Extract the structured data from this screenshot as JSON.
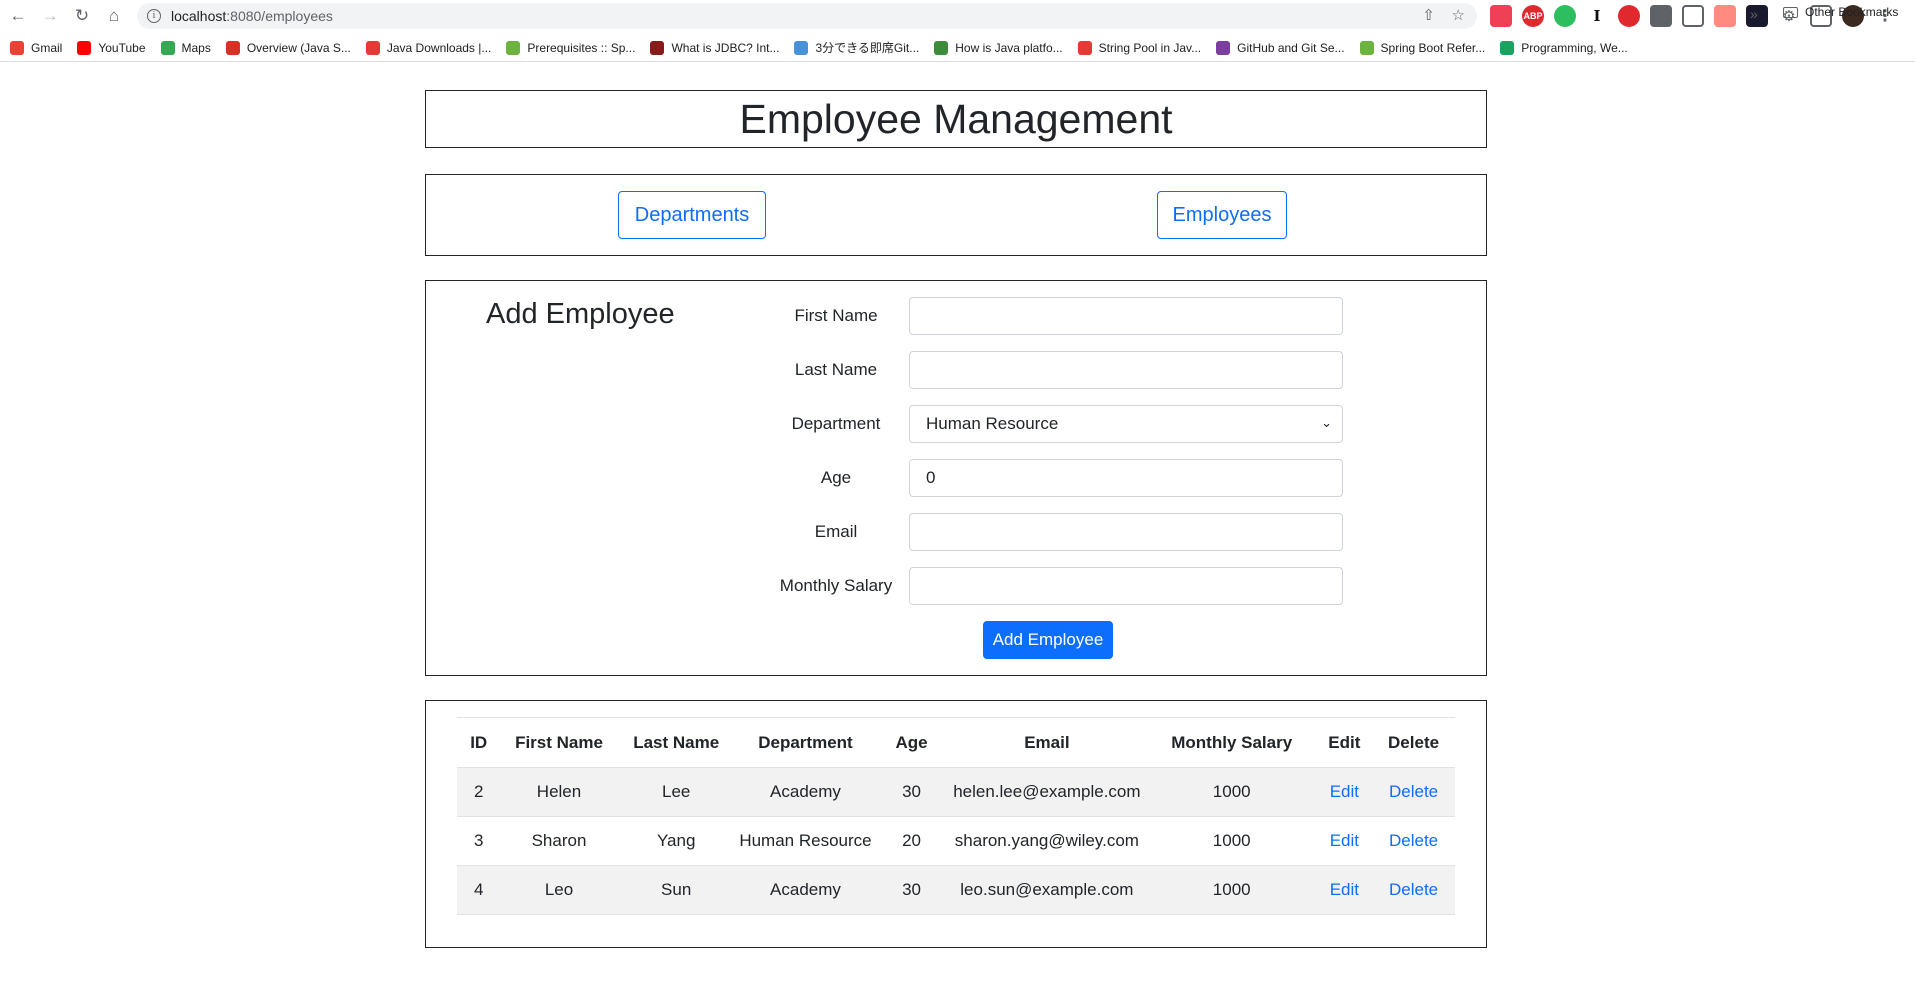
{
  "browser": {
    "url_host": "localhost",
    "url_path": ":8080/employees",
    "bookmarks": [
      {
        "label": "Gmail",
        "icon": "gmail-icon",
        "color": "#ea4335"
      },
      {
        "label": "YouTube",
        "icon": "youtube-icon",
        "color": "#ff0000"
      },
      {
        "label": "Maps",
        "icon": "maps-icon",
        "color": "#34a853"
      },
      {
        "label": "Overview (Java S...",
        "icon": "oracle-icon",
        "color": "#d93025"
      },
      {
        "label": "Java Downloads |...",
        "icon": "oracle-icon",
        "color": "#e53935"
      },
      {
        "label": "Prerequisites :: Sp...",
        "icon": "spring-icon",
        "color": "#6db33f"
      },
      {
        "label": "What is JDBC? Int...",
        "icon": "iw-icon",
        "color": "#8b1a1a"
      },
      {
        "label": "3分できる即席Git...",
        "icon": "link-icon",
        "color": "#4a90d9"
      },
      {
        "label": "How is Java platfo...",
        "icon": "link-icon",
        "color": "#3c8c3c"
      },
      {
        "label": "String Pool in Jav...",
        "icon": "link-icon",
        "color": "#e53935"
      },
      {
        "label": "GitHub and Git Se...",
        "icon": "link-icon",
        "color": "#7b3fa0"
      },
      {
        "label": "Spring Boot Refer...",
        "icon": "spring-icon",
        "color": "#6db33f"
      },
      {
        "label": "Programming, We...",
        "icon": "link-icon",
        "color": "#1aa260"
      }
    ],
    "more": "»",
    "other_bookmarks": "Other Bookmarks"
  },
  "header": {
    "title": "Employee Management"
  },
  "nav": {
    "departments_label": "Departments",
    "employees_label": "Employees"
  },
  "form": {
    "title": "Add Employee",
    "first_name_label": "First Name",
    "first_name_value": "",
    "last_name_label": "Last Name",
    "last_name_value": "",
    "department_label": "Department",
    "department_value": "Human Resource",
    "age_label": "Age",
    "age_value": "0",
    "email_label": "Email",
    "email_value": "",
    "salary_label": "Monthly Salary",
    "salary_value": "",
    "submit_label": "Add Employee"
  },
  "table": {
    "headers": [
      "ID",
      "First Name",
      "Last Name",
      "Department",
      "Age",
      "Email",
      "Monthly Salary",
      "Edit",
      "Delete"
    ],
    "rows": [
      {
        "id": "2",
        "first": "Helen",
        "last": "Lee",
        "dept": "Academy",
        "age": "30",
        "email": "helen.lee@example.com",
        "salary": "1000",
        "edit": "Edit",
        "delete": "Delete"
      },
      {
        "id": "3",
        "first": "Sharon",
        "last": "Yang",
        "dept": "Human Resource",
        "age": "20",
        "email": "sharon.yang@wiley.com",
        "salary": "1000",
        "edit": "Edit",
        "delete": "Delete"
      },
      {
        "id": "4",
        "first": "Leo",
        "last": "Sun",
        "dept": "Academy",
        "age": "30",
        "email": "leo.sun@example.com",
        "salary": "1000",
        "edit": "Edit",
        "delete": "Delete"
      }
    ]
  },
  "colors": {
    "primary": "#0d6efd",
    "text": "#212529",
    "stripe": "#f2f2f2"
  }
}
